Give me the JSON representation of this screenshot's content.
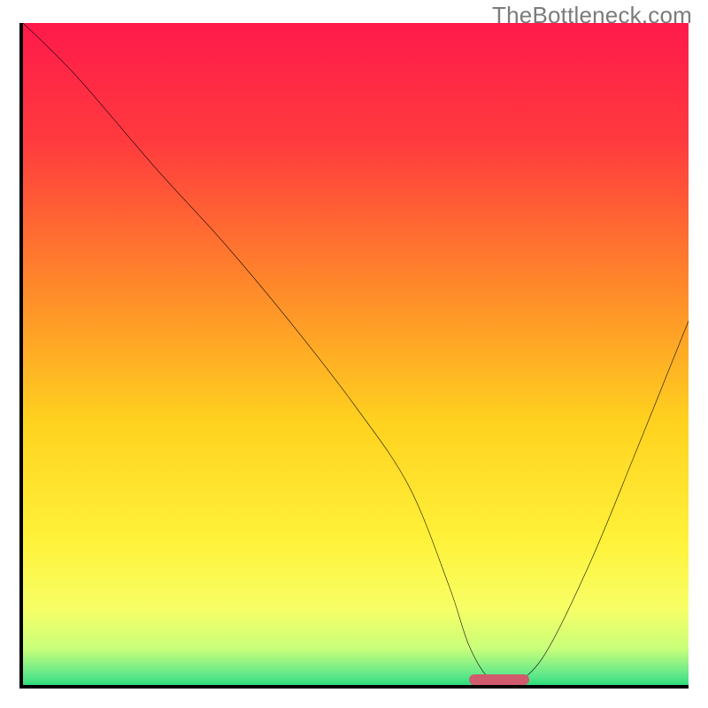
{
  "watermark": "TheBottleneck.com",
  "chart_data": {
    "type": "line",
    "title": "",
    "xlabel": "",
    "ylabel": "",
    "xlim": [
      0,
      100
    ],
    "ylim": [
      0,
      100
    ],
    "series": [
      {
        "name": "bottleneck-curve",
        "x": [
          0,
          8,
          20,
          30,
          40,
          50,
          58,
          64,
          67,
          70,
          73,
          78,
          85,
          92,
          100
        ],
        "y": [
          100,
          92,
          78,
          67,
          55,
          42,
          30,
          15,
          6,
          1,
          0,
          4,
          18,
          35,
          55
        ]
      }
    ],
    "optimal_marker": {
      "x_start": 67,
      "x_end": 76,
      "y": 0
    },
    "gradient_stops": [
      {
        "pos": 0,
        "color": "#ff1a4b"
      },
      {
        "pos": 18,
        "color": "#ff3b3e"
      },
      {
        "pos": 40,
        "color": "#ff8a2a"
      },
      {
        "pos": 60,
        "color": "#ffd21f"
      },
      {
        "pos": 78,
        "color": "#fff23a"
      },
      {
        "pos": 88,
        "color": "#f7ff66"
      },
      {
        "pos": 94,
        "color": "#c9ff7a"
      },
      {
        "pos": 98,
        "color": "#5fe88a"
      },
      {
        "pos": 100,
        "color": "#1fd873"
      }
    ]
  }
}
